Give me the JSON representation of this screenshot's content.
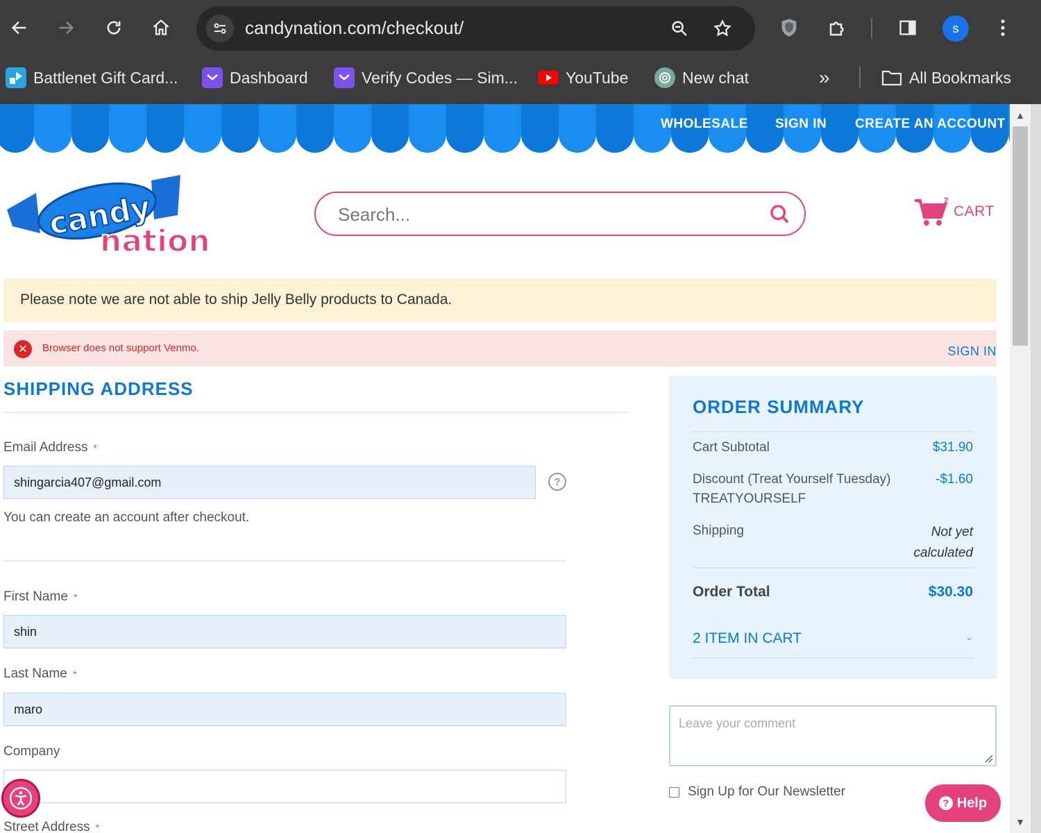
{
  "browser": {
    "url": "candynation.com/checkout/",
    "profile_initial": "s",
    "bookmarks": [
      {
        "label": "Battlenet Gift Card...",
        "icon": "battlenet-icon"
      },
      {
        "label": "Dashboard",
        "icon": "dashboard-bookmark-icon"
      },
      {
        "label": "Verify Codes — Sim...",
        "icon": "verify-codes-bookmark-icon"
      },
      {
        "label": "YouTube",
        "icon": "youtube-icon"
      },
      {
        "label": "New chat",
        "icon": "chatgpt-icon"
      }
    ],
    "all_bookmarks": "All Bookmarks"
  },
  "site": {
    "top_nav": [
      "WHOLESALE",
      "SIGN IN",
      "CREATE AN ACCOUNT"
    ],
    "logo_line1": "candy",
    "logo_line2": "nation",
    "search_placeholder": "Search...",
    "cart_count": "2",
    "cart_label": "CART"
  },
  "notice": "Please note we are not able to ship Jelly Belly products to Canada.",
  "error": {
    "message": "Browser does not support Venmo.",
    "sign_in": "SIGN IN"
  },
  "shipping": {
    "heading": "SHIPPING ADDRESS",
    "email_label": "Email Address",
    "email_value": "shingarcia407@gmail.com",
    "email_note": "You can create an account after checkout.",
    "first_name_label": "First Name",
    "first_name_value": "shin",
    "last_name_label": "Last Name",
    "last_name_value": "maro",
    "company_label": "Company",
    "company_value": "",
    "street_label": "Street Address",
    "required_mark": "*"
  },
  "summary": {
    "heading": "ORDER SUMMARY",
    "subtotal_label": "Cart Subtotal",
    "subtotal_value": "$31.90",
    "discount_label": "Discount (Treat Yourself Tuesday)",
    "discount_code": "TREATYOURSELF",
    "discount_value": "-$1.60",
    "shipping_label": "Shipping",
    "shipping_value_line1": "Not yet",
    "shipping_value_line2": "calculated",
    "total_label": "Order Total",
    "total_value": "$30.30",
    "items_label": "2 ITEM IN CART"
  },
  "comment_placeholder": "Leave your comment",
  "newsletter_label": "Sign Up for Our Newsletter",
  "help_label": "Help",
  "colors": {
    "brand_blue": "#0c78d8",
    "brand_pink": "#e5417c"
  }
}
